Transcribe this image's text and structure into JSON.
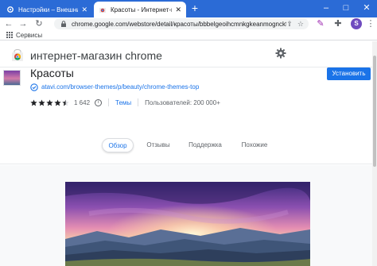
{
  "browser": {
    "tabs": [
      {
        "title": "Настройки – Внешний вид",
        "active": false
      },
      {
        "title": "Красоты - Интернет-магазин Ch",
        "active": true
      }
    ],
    "new_tab_label": "+",
    "window_controls": {
      "minimize": "–",
      "maximize": "□",
      "close": "✕"
    },
    "address": "chrome.google.com/webstore/detail/красоты/bbbelgeoihcmnkgkeanmognckfichm?hl=ru",
    "profile_initial": "S",
    "bookmarks_label": "Сервисы"
  },
  "store": {
    "name": "интернет-магазин chrome"
  },
  "item": {
    "title": "Красоты",
    "publisher_url": "atavi.com/browser-themes/p/beauty/chrome-themes-top",
    "rating": 4.5,
    "rating_count": "1 642",
    "category": "Темы",
    "users": "Пользователей: 200 000+",
    "install_label": "Установить"
  },
  "page_tabs": [
    {
      "label": "Обзор",
      "active": true
    },
    {
      "label": "Отзывы",
      "active": false
    },
    {
      "label": "Поддержка",
      "active": false
    },
    {
      "label": "Похожие",
      "active": false
    }
  ],
  "colors": {
    "titlebar": "#2b6bd6",
    "accent": "#1a73e8",
    "star": "#202124"
  }
}
